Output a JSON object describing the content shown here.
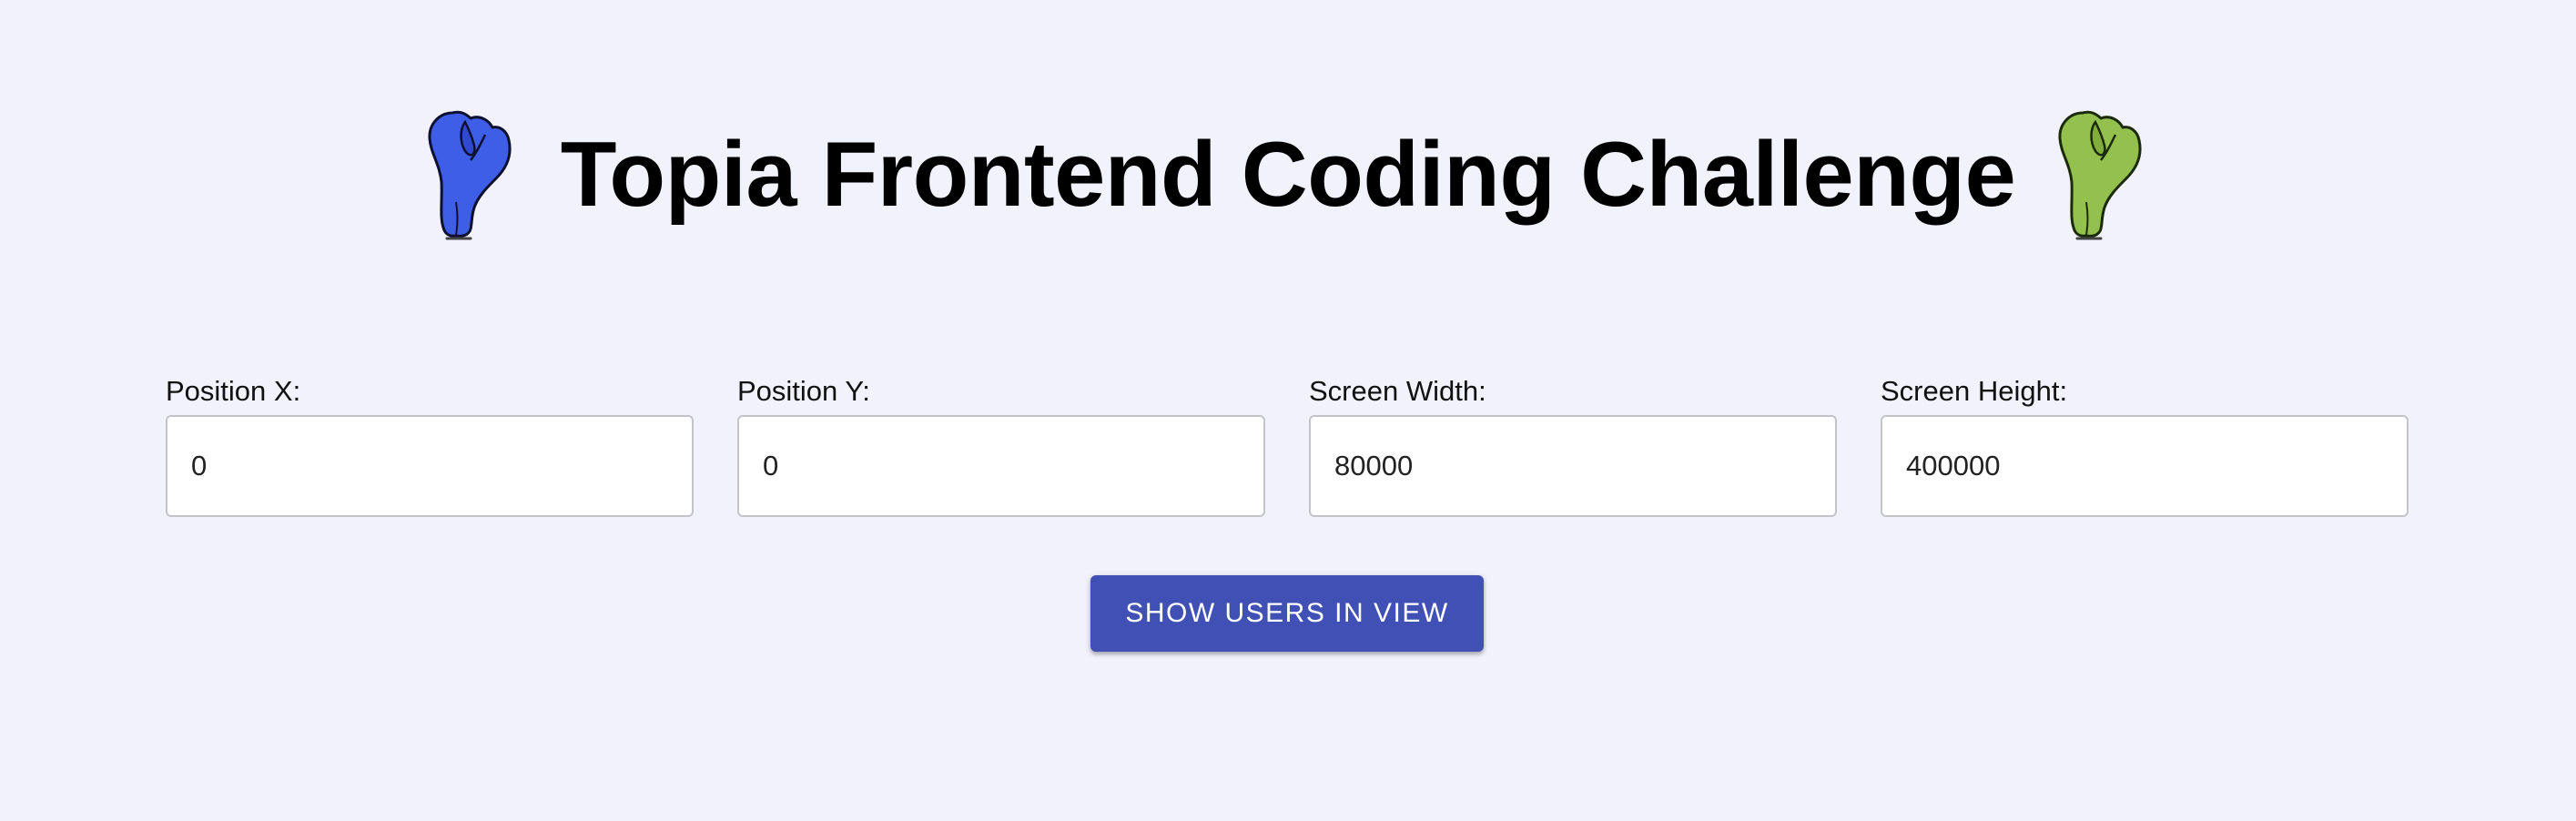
{
  "header": {
    "title": "Topia Frontend Coding Challenge",
    "left_mascot_icon": "blue-creature-icon",
    "right_mascot_icon": "green-creature-icon",
    "left_mascot_color": "#3f5ee8",
    "right_mascot_color": "#94c14e"
  },
  "form": {
    "fields": [
      {
        "label": "Position X:",
        "value": "0"
      },
      {
        "label": "Position Y:",
        "value": "0"
      },
      {
        "label": "Screen Width:",
        "value": "80000"
      },
      {
        "label": "Screen Height:",
        "value": "400000"
      }
    ],
    "submit_label": "SHOW USERS IN VIEW"
  },
  "colors": {
    "background": "#f1f2fc",
    "button": "#4050b5",
    "button_text": "#ffffff"
  }
}
